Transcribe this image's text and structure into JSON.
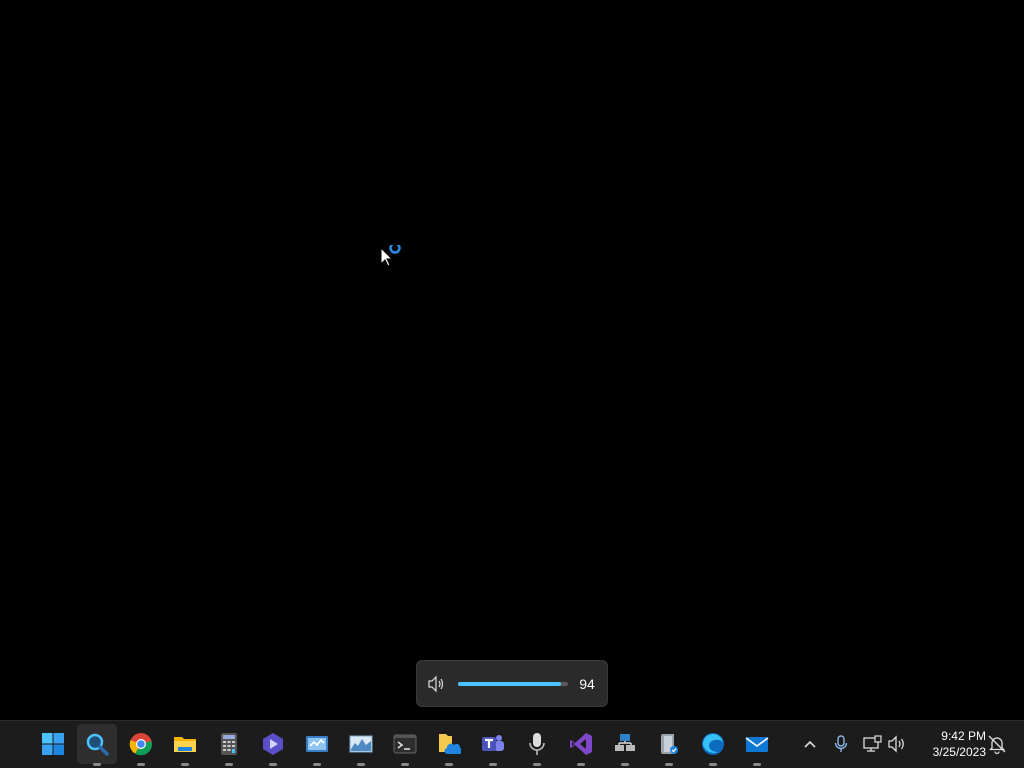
{
  "volume_flyout": {
    "value": "94",
    "level_percent": 94,
    "icon": "speaker-icon",
    "accent": "#4cc2ff"
  },
  "taskbar": {
    "apps": [
      {
        "name": "start-button",
        "icon": "windows-logo-icon"
      },
      {
        "name": "taskbar-search",
        "icon": "magnifier-icon"
      },
      {
        "name": "taskbar-chrome",
        "icon": "chrome-icon"
      },
      {
        "name": "taskbar-file-explorer",
        "icon": "folder-icon"
      },
      {
        "name": "taskbar-calculator",
        "icon": "calculator-icon"
      },
      {
        "name": "taskbar-app-triangle",
        "icon": "triangle-app-icon"
      },
      {
        "name": "taskbar-network-app",
        "icon": "network-app-icon"
      },
      {
        "name": "taskbar-performance-monitor",
        "icon": "chart-icon"
      },
      {
        "name": "taskbar-terminal",
        "icon": "terminal-icon"
      },
      {
        "name": "taskbar-onedrive-folder",
        "icon": "cloud-folder-icon"
      },
      {
        "name": "taskbar-teams",
        "icon": "teams-icon"
      },
      {
        "name": "taskbar-microphone-app",
        "icon": "microphone-icon"
      },
      {
        "name": "taskbar-visual-studio",
        "icon": "visual-studio-icon"
      },
      {
        "name": "taskbar-network-tool",
        "icon": "network-tool-icon"
      },
      {
        "name": "taskbar-book-app",
        "icon": "book-icon"
      },
      {
        "name": "taskbar-edge",
        "icon": "edge-icon"
      },
      {
        "name": "taskbar-mail",
        "icon": "mail-icon"
      }
    ],
    "tray": {
      "time": "9:42 PM",
      "date": "3/25/2023",
      "icons": [
        "chevron-up-icon",
        "microphone-icon",
        "network-icon",
        "speaker-icon",
        "notification-icon"
      ]
    }
  }
}
